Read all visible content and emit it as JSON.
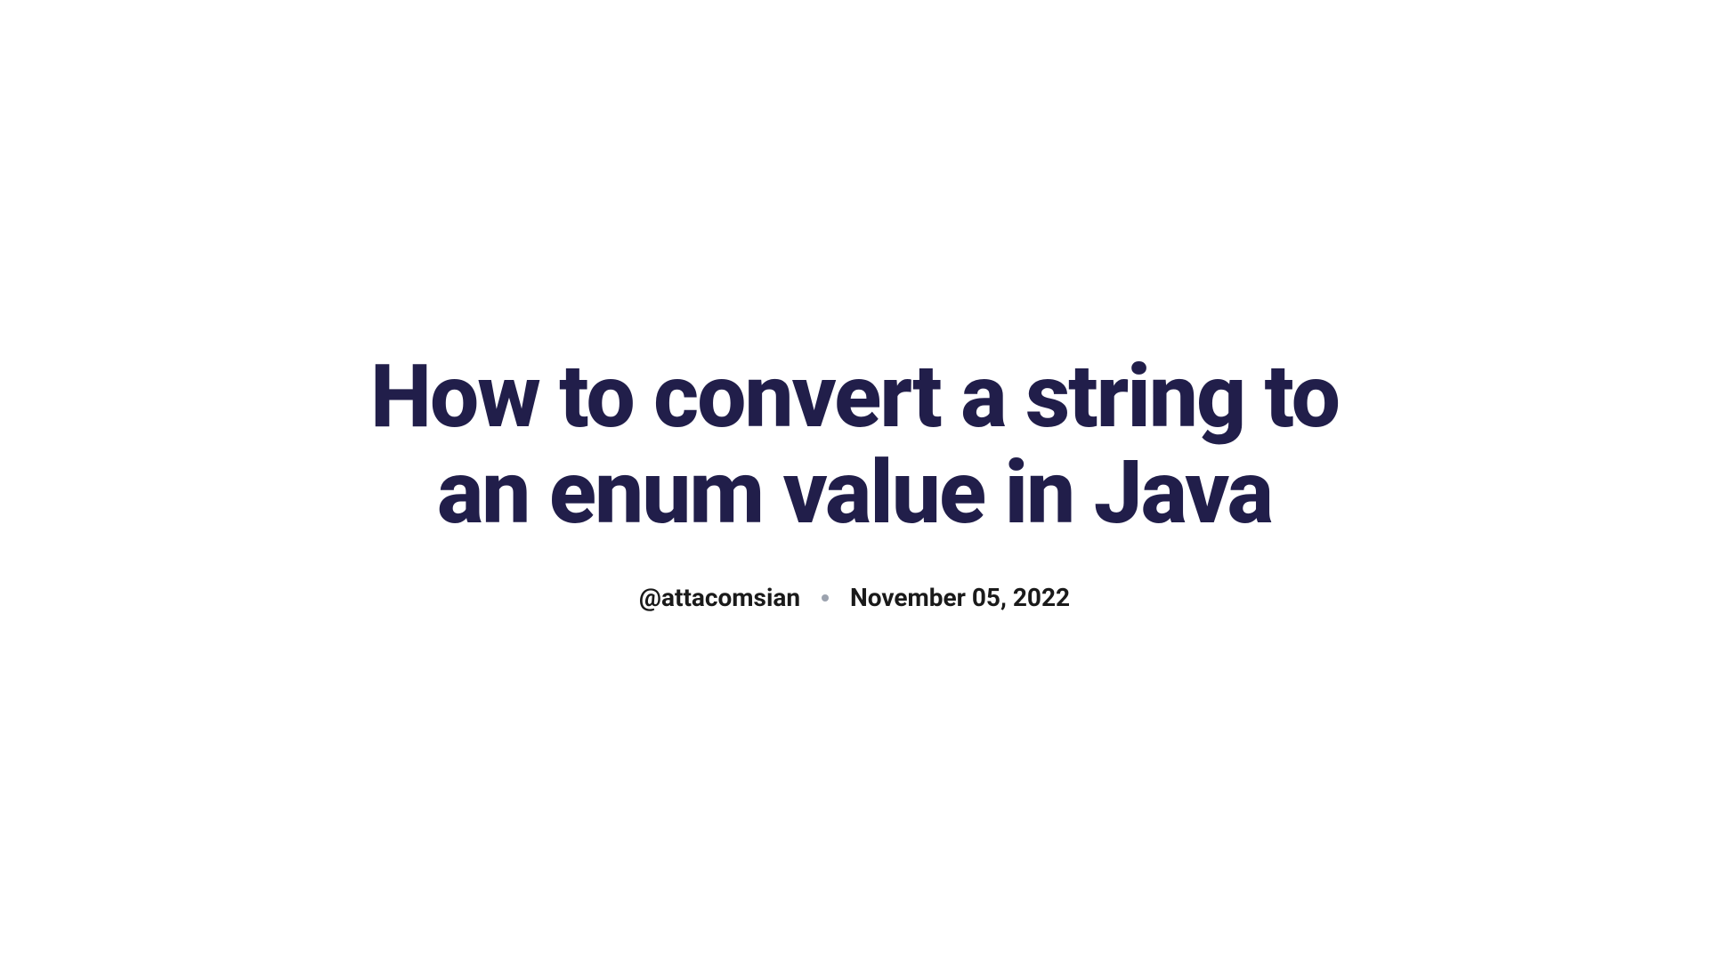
{
  "article": {
    "title": "How to convert a string to an enum value in Java",
    "author": "@attacomsian",
    "date": "November 05, 2022"
  }
}
